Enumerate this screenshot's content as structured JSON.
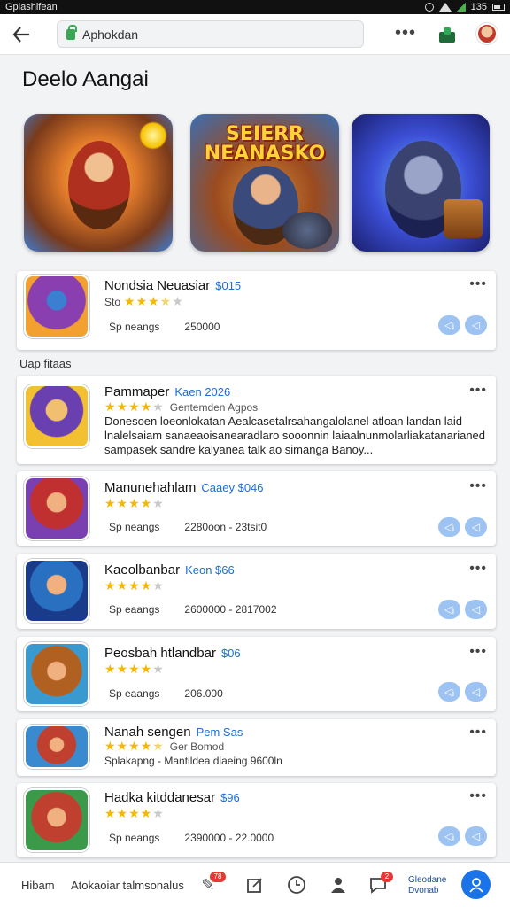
{
  "status_bar": {
    "title": "Gplashlfean",
    "battery": "135"
  },
  "address_bar": {
    "url": "Aphokdan"
  },
  "page": {
    "title": "Deelo Aangai"
  },
  "featured": [
    {
      "name": "featured-banner-1",
      "title": ""
    },
    {
      "name": "featured-banner-2",
      "title": "SEIERR NEANASKO"
    },
    {
      "name": "featured-banner-3",
      "title": ""
    }
  ],
  "section_label": "Uap fitaas",
  "apps": [
    {
      "title": "Nondsia Neuasiar",
      "price": "$015",
      "rating_label": "Sto",
      "stars": 3.5,
      "meta_left": "Sp neangs",
      "meta_right": "250000",
      "pills": [
        "◁ᵢ",
        "◁"
      ]
    },
    {
      "title": "Pammaper",
      "price": "Kaen 2026",
      "stars": 4,
      "developer": "Gentemden Agpos",
      "description": "Donesoen loeonlokatan Aealcasetalrsahangalolanel atloan landan laid lnalelsaiam sanaeaoisanearadlaro sooonnin laiaalnunmolarliakatanarianed sampasek sandre kalyanea talk ao simanga Banoy..."
    },
    {
      "title": "Manunehahlam",
      "price": "Caaey $046",
      "stars": 4,
      "meta_left": "Sp neangs",
      "meta_right": "2280oon - 23tsit0",
      "pills": [
        "◁ᵢ",
        "◁"
      ]
    },
    {
      "title": "Kaeolbanbar",
      "price": "Keon $66",
      "stars": 4,
      "meta_left": "Sp eaangs",
      "meta_right": "2600000 - 2817002",
      "pills": [
        "◁ᵢ",
        "◁"
      ]
    },
    {
      "title": "Peosbah htlandbar",
      "price": "$06",
      "stars": 4,
      "meta_left": "Sp eaangs",
      "meta_right": "206.000",
      "pills": [
        "◁ᵢ",
        "◁"
      ]
    },
    {
      "title": "Nanah sengen",
      "price": "Pem Sas",
      "stars": 4.5,
      "developer": "Ger Bomod",
      "meta_line": "Splakapng - Mantildea diaeing 9600ln"
    },
    {
      "title": "Hadka kitddanesar",
      "price": "$96",
      "stars": 4,
      "meta_left": "Sp neangs",
      "meta_right": "2390000 - 22.0000",
      "pills": [
        "◁ᵢ",
        "◁"
      ]
    }
  ],
  "bottom_bar": {
    "left_label": "Hibam",
    "center_label": "Atokaoiar talmsonalus",
    "badge_1": "78",
    "badge_2": "2",
    "small_text_1": "Gleodane",
    "small_text_2": "Dvonab"
  },
  "colors": {
    "accent": "#1a73e8",
    "price_blue": "#1a6ed8",
    "star": "#f5b800",
    "pill": "#9dc3f2"
  }
}
